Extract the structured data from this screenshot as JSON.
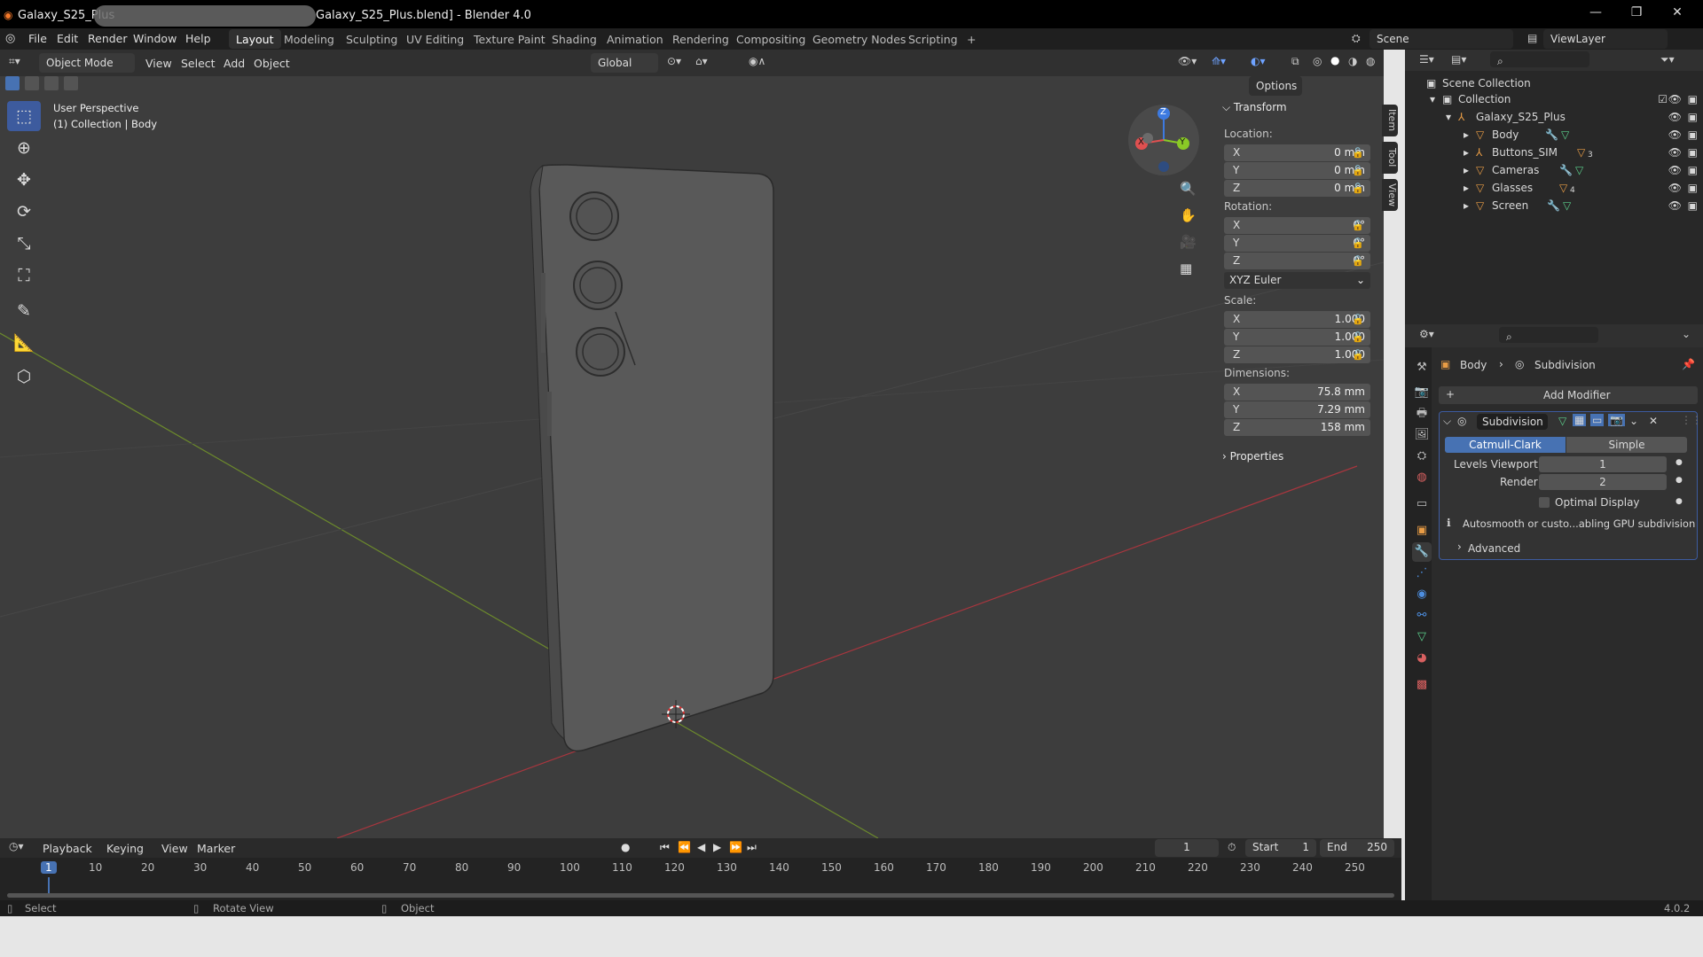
{
  "window": {
    "title_prefix": "Galaxy_S25_Plus",
    "title_suffix": "Galaxy_S25_Plus.blend] - Blender 4.0",
    "min": "—",
    "max": "❐",
    "close": "✕"
  },
  "menus": [
    "File",
    "Edit",
    "Render",
    "Window",
    "Help"
  ],
  "workspaces": [
    "Layout",
    "Modeling",
    "Sculpting",
    "UV Editing",
    "Texture Paint",
    "Shading",
    "Animation",
    "Rendering",
    "Compositing",
    "Geometry Nodes",
    "Scripting",
    "+"
  ],
  "scene": {
    "name": "Scene",
    "view_layer": "ViewLayer"
  },
  "viewport_header": {
    "mode": "Object Mode",
    "menus": [
      "View",
      "Select",
      "Add",
      "Object"
    ],
    "transform_orientation": "Global",
    "options": "Options"
  },
  "viewport": {
    "perspective": "User Perspective",
    "context": "(1) Collection | Body",
    "gizmo": {
      "x": "X",
      "y": "Y",
      "z": "Z"
    }
  },
  "transform": {
    "title": "Transform",
    "location_label": "Location:",
    "location": [
      {
        "axis": "X",
        "value": "0 mm"
      },
      {
        "axis": "Y",
        "value": "0 mm"
      },
      {
        "axis": "Z",
        "value": "0 mm"
      }
    ],
    "rotation_label": "Rotation:",
    "rotation": [
      {
        "axis": "X",
        "value": "0°"
      },
      {
        "axis": "Y",
        "value": "0°"
      },
      {
        "axis": "Z",
        "value": "0°"
      }
    ],
    "rotation_mode": "XYZ Euler",
    "scale_label": "Scale:",
    "scale": [
      {
        "axis": "X",
        "value": "1.000"
      },
      {
        "axis": "Y",
        "value": "1.000"
      },
      {
        "axis": "Z",
        "value": "1.000"
      }
    ],
    "dimensions_label": "Dimensions:",
    "dimensions": [
      {
        "axis": "X",
        "value": "75.8 mm"
      },
      {
        "axis": "Y",
        "value": "7.29 mm"
      },
      {
        "axis": "Z",
        "value": "158 mm"
      }
    ],
    "properties": "Properties"
  },
  "side_tabs": [
    "Item",
    "Tool",
    "View"
  ],
  "outliner": {
    "root": "Scene Collection",
    "collection": "Collection",
    "object": "Galaxy_S25_Plus",
    "children": [
      {
        "name": "Body",
        "badge": ""
      },
      {
        "name": "Buttons_SIM",
        "badge": "3"
      },
      {
        "name": "Cameras",
        "badge": ""
      },
      {
        "name": "Glasses",
        "badge": "4"
      },
      {
        "name": "Screen",
        "badge": ""
      }
    ]
  },
  "properties": {
    "breadcrumb_object": "Body",
    "breadcrumb_modifier": "Subdivision",
    "add_modifier": "Add Modifier",
    "modifier_name": "Subdivision",
    "algo_catmull": "Catmull-Clark",
    "algo_simple": "Simple",
    "levels_viewport_label": "Levels Viewport",
    "levels_viewport": "1",
    "render_label": "Render",
    "render_value": "2",
    "optimal_display": "Optimal Display",
    "info": "Autosmooth or custo...abling GPU subdivision",
    "advanced": "Advanced"
  },
  "timeline": {
    "menus": [
      "Playback",
      "Keying",
      "View",
      "Marker"
    ],
    "current_frame": "1",
    "start_label": "Start",
    "start": "1",
    "end_label": "End",
    "end": "250",
    "ticks": [
      "1",
      "10",
      "20",
      "30",
      "40",
      "50",
      "60",
      "70",
      "80",
      "90",
      "100",
      "110",
      "120",
      "130",
      "140",
      "150",
      "160",
      "170",
      "180",
      "190",
      "200",
      "210",
      "220",
      "230",
      "240",
      "250"
    ]
  },
  "status": {
    "select": "Select",
    "rotate": "Rotate View",
    "object": "Object",
    "version": "4.0.2"
  },
  "colors": {
    "accent": "#4772b3",
    "active_tab": "#303030",
    "viewport_bg": "#3d3d3d"
  }
}
